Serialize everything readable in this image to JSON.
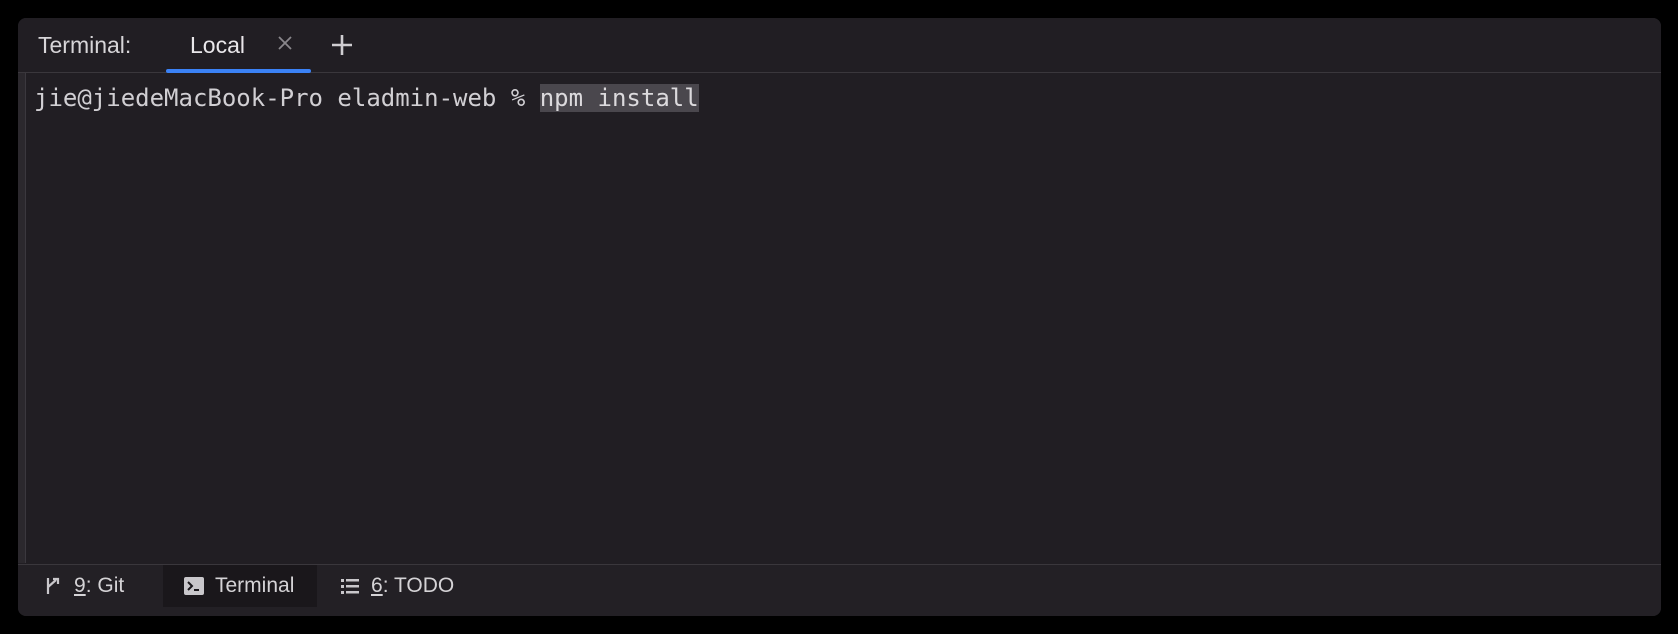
{
  "header": {
    "title": "Terminal:",
    "tabs": [
      {
        "label": "Local",
        "active": true,
        "close_icon": "close-icon"
      }
    ],
    "add_tab_icon": "plus-icon"
  },
  "terminal": {
    "prompt": "jie@jiedeMacBook-Pro eladmin-web % ",
    "command": "npm install"
  },
  "bottom_bar": {
    "items": [
      {
        "mnemonic": "9",
        "label": ": Git",
        "icon": "git-branch-icon",
        "active": false
      },
      {
        "mnemonic": "",
        "label": "Terminal",
        "icon": "terminal-icon",
        "active": true
      },
      {
        "mnemonic": "6",
        "label": ": TODO",
        "icon": "list-icon",
        "active": false
      }
    ]
  },
  "colors": {
    "background": "#211e23",
    "tab_underline": "#3b82f6",
    "selection": "#4a474d",
    "text": "#d1cfd3"
  }
}
